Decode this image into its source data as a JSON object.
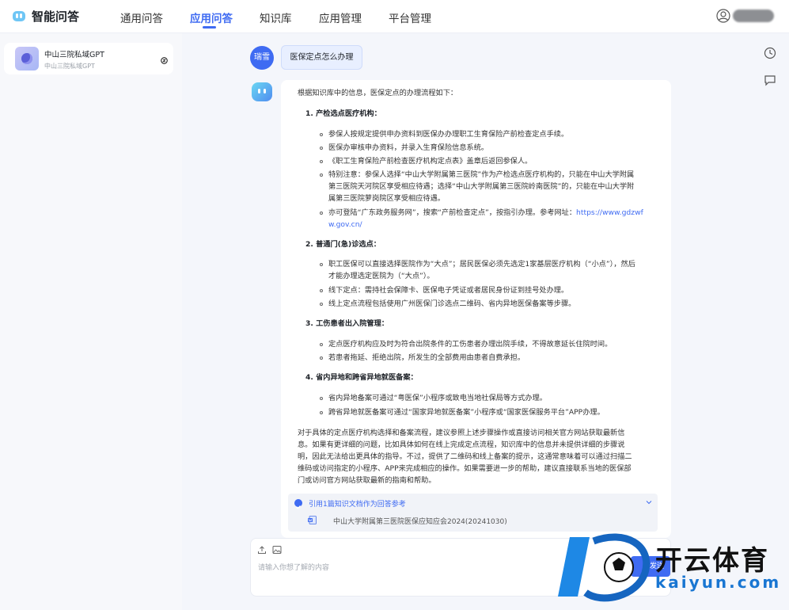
{
  "app": {
    "title": "智能问答"
  },
  "nav": [
    {
      "label": "通用问答",
      "active": false
    },
    {
      "label": "应用问答",
      "active": true
    },
    {
      "label": "知识库",
      "active": false
    },
    {
      "label": "应用管理",
      "active": false
    },
    {
      "label": "平台管理",
      "active": false
    }
  ],
  "sidebar": {
    "chat": {
      "title": "中山三院私域GPT",
      "subtitle": "中山三院私域GPT"
    }
  },
  "conversation": {
    "user": {
      "avatar_text": "瑞雪",
      "message": "医保定点怎么办理"
    },
    "answer": {
      "intro": "根据知识库中的信息，医保定点的办理流程如下：",
      "sections": [
        {
          "heading": "1. 产检选点医疗机构：",
          "bullets": [
            [
              "参保人按规定提供申办资料到医保办办理职工生育保险产前检查定点手续。"
            ],
            [
              "医保办审核申办资料，并录入生育保险信息系统。"
            ],
            [
              "《职工生育保险产前检查医疗机构定点表》盖章后返回参保人。"
            ],
            [
              "特别注意：参保人选择“中山大学附属第三医院”作为产检选点医疗机构的，只能在中山大学附属",
              "第三医院天河院区享受相应待遇；选择“中山大学附属第三医院岭南医院”的，只能在中山大学附",
              "属第三医院萝岗院区享受相应待遇。"
            ],
            [
              "亦可登陆“广东政务服务网”，搜索“产前检查定点”，按指引办理。参考网址：",
              "w.gov.cn/"
            ]
          ],
          "link_part": "https://www.gdzwf"
        },
        {
          "heading": "2. 普通门(急)诊选点：",
          "bullets": [
            [
              "职工医保可以直接选择医院作为“大点”；居民医保必须先选定1家基层医疗机构（“小点”），然后",
              "才能办理选定医院为（“大点”）。"
            ],
            [
              "线下定点：需持社会保障卡、医保电子凭证或者居民身份证到挂号处办理。"
            ],
            [
              "线上定点流程包括使用广州医保门诊选点二维码、省内异地医保备案等步骤。"
            ]
          ]
        },
        {
          "heading": "3. 工伤患者出入院管理：",
          "bullets": [
            [
              "定点医疗机构应及时为符合出院条件的工伤患者办理出院手续，不得故意延长住院时间。"
            ],
            [
              "若患者拖延、拒绝出院，所发生的全部费用由患者自费承担。"
            ]
          ]
        },
        {
          "heading": "4. 省内异地和跨省异地就医备案：",
          "bullets": [
            [
              "省内异地备案可通过“粤医保”小程序或致电当地社保局等方式办理。"
            ],
            [
              "跨省异地就医备案可通过“国家异地就医备案”小程序或“国家医保服务平台”APP办理。"
            ]
          ]
        }
      ],
      "conclusion": [
        "对于具体的定点医疗机构选择和备案流程，建议参照上述步骤操作或直接访问相关官方网站获取最新信",
        "息。如果有更详细的问题，比如具体如何在线上完成定点流程，知识库中的信息并未提供详细的步骤说",
        "明，因此无法给出更具体的指导。不过，提供了二维码和线上备案的提示，这通常意味着可以通过扫描二",
        "维码或访问指定的小程序、APP来完成相应的操作。如果需要进一步的帮助，建议直接联系当地的医保部",
        "门或访问官方网站获取最新的指南和帮助。"
      ],
      "reference": {
        "title": "引用1篇知识文档作为回答参考",
        "document": "中山大学附属第三医院医保应知应会2024(20241030)"
      }
    }
  },
  "input": {
    "placeholder": "请输入你想了解的内容",
    "send_label": "发送"
  },
  "watermark": {
    "text": "开云体育",
    "sub": "kaiyun.com"
  },
  "colors": {
    "accent": "#3f6bf2",
    "background": "#f4f6fb"
  }
}
